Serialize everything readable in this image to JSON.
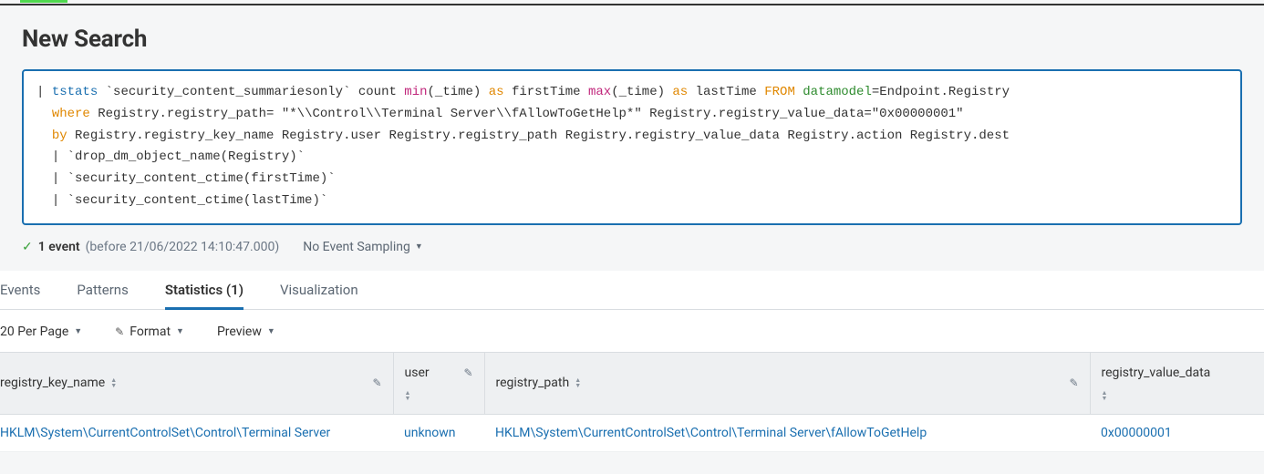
{
  "page_title": "New Search",
  "search_query": {
    "line1": {
      "pipe": "| ",
      "cmd": "tstats",
      "macro": " `security_content_summariesonly` count ",
      "min": "min",
      "min_args": "(_time) ",
      "as1": "as",
      "ft": " firstTime ",
      "max": "max",
      "max_args": "(_time) ",
      "as2": "as",
      "lt": " lastTime ",
      "from": "FROM",
      "dm": " datamodel",
      "dm_val": "=Endpoint.Registry"
    },
    "line2": {
      "indent": "  ",
      "where": "where",
      "rest": " Registry.registry_path= \"*\\\\Control\\\\Terminal Server\\\\fAllowToGetHelp*\" Registry.registry_value_data=\"0x00000001\""
    },
    "line3": {
      "indent": "  ",
      "by": "by",
      "rest": " Registry.registry_key_name Registry.user Registry.registry_path Registry.registry_value_data Registry.action Registry.dest"
    },
    "line4": "  | `drop_dm_object_name(Registry)`",
    "line5": "  | `security_content_ctime(firstTime)`",
    "line6": "  | `security_content_ctime(lastTime)`"
  },
  "status": {
    "count": "1 event",
    "sub": " (before 21/06/2022 14:10:47.000)",
    "sampling": "No Event Sampling"
  },
  "tabs": {
    "events": "Events",
    "patterns": "Patterns",
    "statistics": "Statistics (1)",
    "visualization": "Visualization"
  },
  "controls": {
    "perpage": "20 Per Page",
    "format": "Format",
    "preview": "Preview"
  },
  "columns": {
    "key": "registry_key_name",
    "user": "user",
    "path": "registry_path",
    "val": "registry_value_data"
  },
  "row1": {
    "key": "HKLM\\System\\CurrentControlSet\\Control\\Terminal Server",
    "user": "unknown",
    "path": "HKLM\\System\\CurrentControlSet\\Control\\Terminal Server\\fAllowToGetHelp",
    "val": "0x00000001"
  }
}
